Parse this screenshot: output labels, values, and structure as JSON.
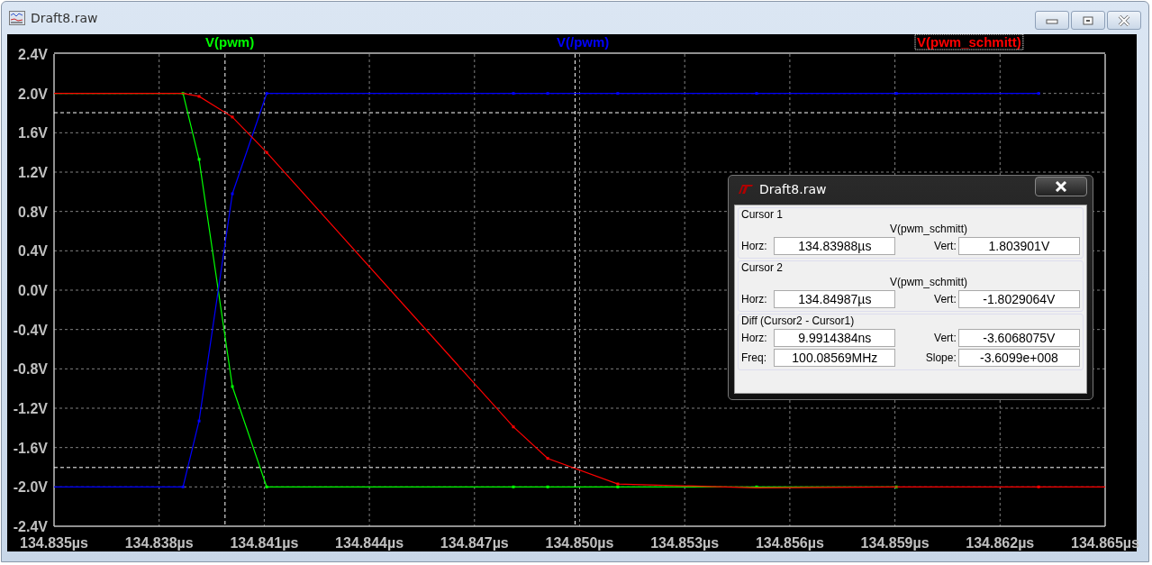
{
  "window": {
    "title": "Draft8.raw"
  },
  "plot": {
    "chart_data": {
      "type": "line",
      "x": [
        134.835,
        134.83868,
        134.83914,
        134.84009,
        134.84107,
        134.84811,
        134.84909,
        134.85109,
        134.85505,
        134.85904,
        134.8631,
        134.865
      ],
      "series": [
        {
          "name": "V(pwm)",
          "color": "#00ff00",
          "marker": "square",
          "values": [
            2.0,
            2.0,
            1.33,
            -0.98,
            -2.0,
            -2.0,
            -2.0,
            -2.0,
            -2.0,
            -2.0,
            null,
            null
          ]
        },
        {
          "name": "V(/pwm)",
          "color": "#0000ff",
          "marker": "square",
          "values": [
            -2.0,
            -2.0,
            -1.33,
            0.98,
            2.0,
            2.0,
            2.0,
            2.0,
            2.0,
            2.0,
            2.0,
            null
          ]
        },
        {
          "name": "V(pwm_schmitt)",
          "color": "#ff0000",
          "marker": "square",
          "values": [
            2.0,
            2.0,
            1.97,
            1.76,
            1.4,
            -1.39,
            -1.71,
            -1.97,
            -2.01,
            -2.0,
            -2.0,
            -2.0
          ]
        }
      ],
      "xlim": [
        134.835,
        134.865
      ],
      "ylim": [
        -2.4,
        2.4
      ],
      "xticks": [
        {
          "value": 134.835,
          "label": "134.835µs"
        },
        {
          "value": 134.838,
          "label": "134.838µs"
        },
        {
          "value": 134.841,
          "label": "134.841µs"
        },
        {
          "value": 134.844,
          "label": "134.844µs"
        },
        {
          "value": 134.847,
          "label": "134.847µs"
        },
        {
          "value": 134.85,
          "label": "134.850µs"
        },
        {
          "value": 134.853,
          "label": "134.853µs"
        },
        {
          "value": 134.856,
          "label": "134.856µs"
        },
        {
          "value": 134.859,
          "label": "134.859µs"
        },
        {
          "value": 134.862,
          "label": "134.862µs"
        },
        {
          "value": 134.865,
          "label": "134.865µs"
        }
      ],
      "yticks": [
        {
          "value": 2.4,
          "label": "2.4V"
        },
        {
          "value": 2.0,
          "label": "2.0V"
        },
        {
          "value": 1.6,
          "label": "1.6V"
        },
        {
          "value": 1.2,
          "label": "1.2V"
        },
        {
          "value": 0.8,
          "label": "0.8V"
        },
        {
          "value": 0.4,
          "label": "0.4V"
        },
        {
          "value": 0.0,
          "label": "0.0V"
        },
        {
          "value": -0.4,
          "label": "-0.4V"
        },
        {
          "value": -0.8,
          "label": "-0.8V"
        },
        {
          "value": -1.2,
          "label": "-1.2V"
        },
        {
          "value": -1.6,
          "label": "-1.6V"
        },
        {
          "value": -2.0,
          "label": "-2.0V"
        },
        {
          "value": -2.4,
          "label": "-2.4V"
        }
      ],
      "grid": true
    },
    "legend": [
      {
        "selected": false
      },
      {
        "selected": false
      },
      {
        "selected": true
      }
    ]
  },
  "cursor_dialog": {
    "title": "Draft8.raw",
    "groups": [
      {
        "label": "Cursor 1",
        "trace": "V(pwm_schmitt)",
        "rows": [
          [
            {
              "label": "Horz:",
              "value": "134.83988µs"
            },
            {
              "label": "Vert:",
              "value": "1.803901V"
            }
          ]
        ]
      },
      {
        "label": "Cursor 2",
        "trace": "V(pwm_schmitt)",
        "rows": [
          [
            {
              "label": "Horz:",
              "value": "134.84987µs"
            },
            {
              "label": "Vert:",
              "value": "-1.8029064V"
            }
          ]
        ]
      },
      {
        "label": "Diff (Cursor2 - Cursor1)",
        "rows": [
          [
            {
              "label": "Horz:",
              "value": "9.9914384ns"
            },
            {
              "label": "Vert:",
              "value": "-3.6068075V"
            }
          ],
          [
            {
              "label": "Freq:",
              "value": "100.08569MHz"
            },
            {
              "label": "Slope:",
              "value": "-3.6099e+008"
            }
          ]
        ]
      }
    ]
  }
}
